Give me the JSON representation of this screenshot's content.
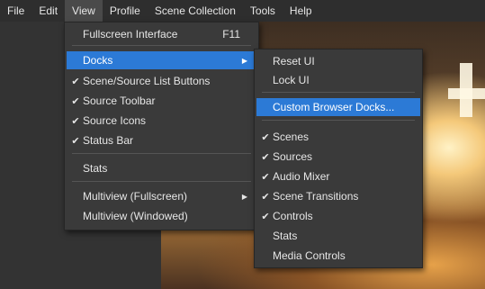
{
  "menubar": {
    "items": [
      "File",
      "Edit",
      "View",
      "Profile",
      "Scene Collection",
      "Tools",
      "Help"
    ]
  },
  "view_menu": {
    "fullscreen": {
      "label": "Fullscreen Interface",
      "shortcut": "F11"
    },
    "docks": "Docks",
    "scene_source_list_buttons": "Scene/Source List Buttons",
    "source_toolbar": "Source Toolbar",
    "source_icons": "Source Icons",
    "status_bar": "Status Bar",
    "stats": "Stats",
    "multiview_fullscreen": "Multiview (Fullscreen)",
    "multiview_windowed": "Multiview (Windowed)"
  },
  "docks_menu": {
    "reset_ui": "Reset UI",
    "lock_ui": "Lock UI",
    "custom_browser_docks": "Custom Browser Docks...",
    "scenes": "Scenes",
    "sources": "Sources",
    "audio_mixer": "Audio Mixer",
    "scene_transitions": "Scene Transitions",
    "controls": "Controls",
    "stats": "Stats",
    "media_controls": "Media Controls"
  },
  "colors": {
    "highlight": "#2c7ad6",
    "menu_bg": "#3a3a3a",
    "menubar_bg": "#2e2e2e"
  }
}
